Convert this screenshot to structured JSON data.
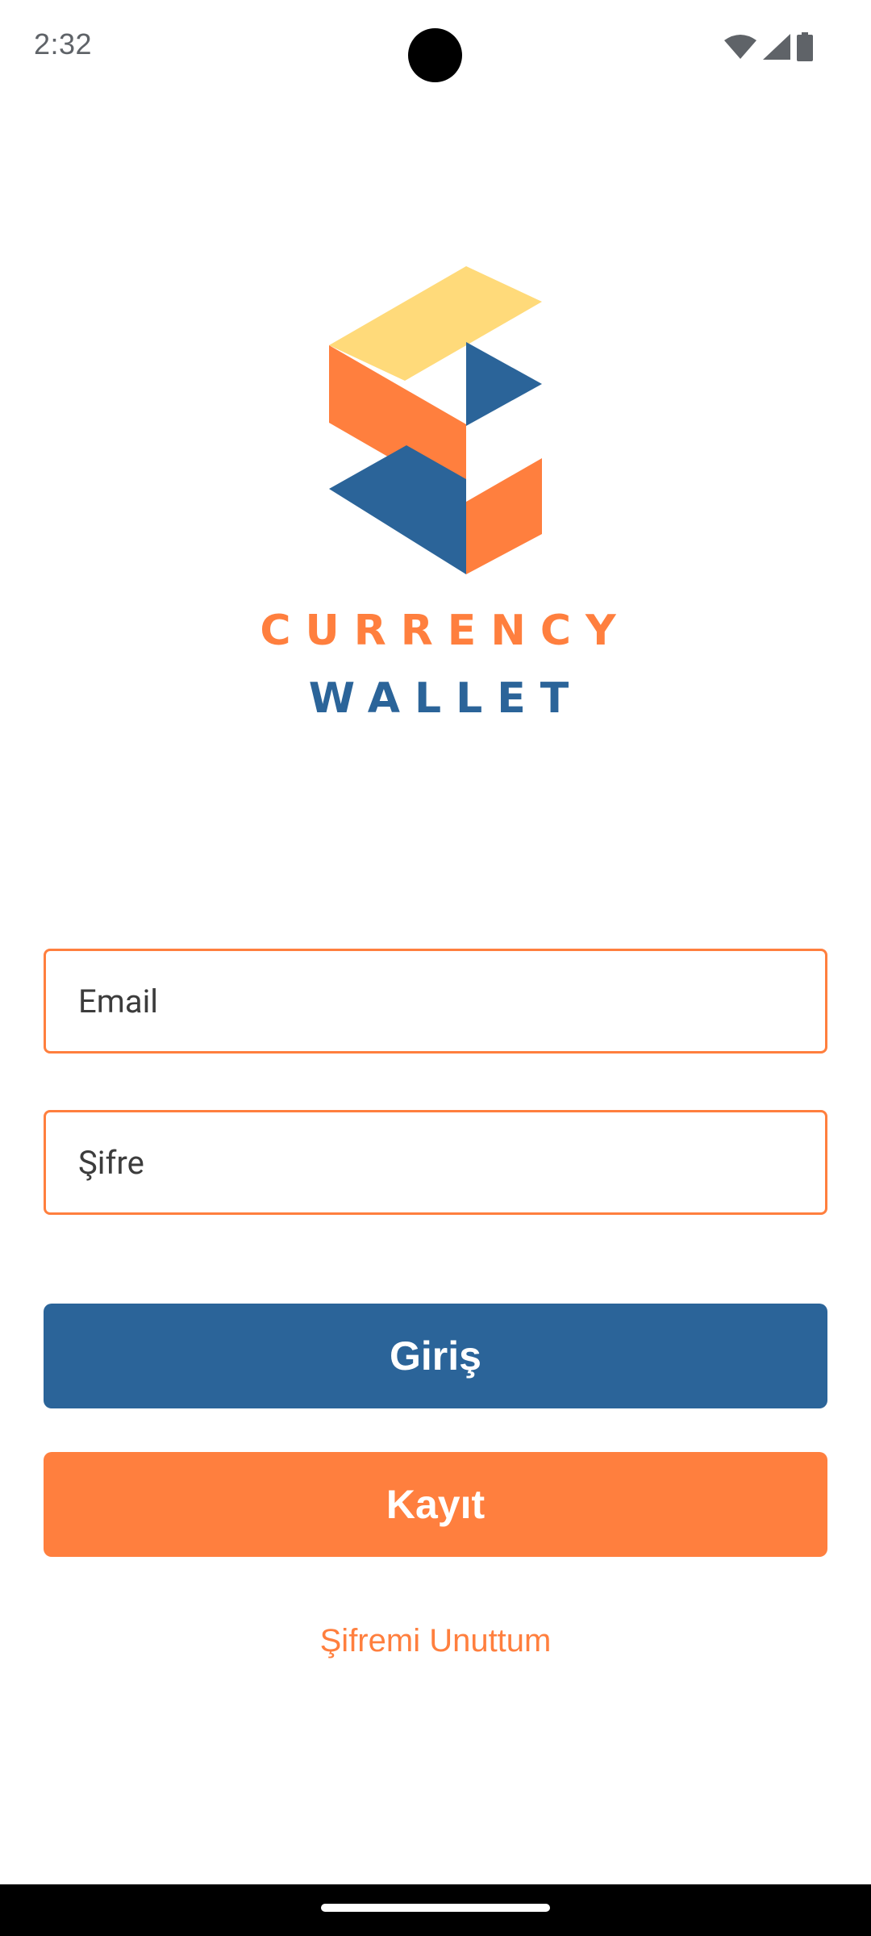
{
  "status_bar": {
    "time": "2:32"
  },
  "brand": {
    "line1": "CURRENCY",
    "line2": "WALLET",
    "colors": {
      "orange": "#FF7F3E",
      "blue": "#2B6499",
      "yellow": "#FFDA7A"
    }
  },
  "form": {
    "email_placeholder": "Email",
    "password_placeholder": "Şifre",
    "field_border_color": "#FF7F3E"
  },
  "buttons": {
    "login_label": "Giriş",
    "login_color": "#2B6499",
    "register_label": "Kayıt",
    "register_color": "#FF7F3E"
  },
  "links": {
    "forgot_password": "Şifremi Unuttum",
    "forgot_password_color": "#FF7F3E"
  },
  "icons": {
    "wifi": "wifi-icon",
    "signal": "signal-icon",
    "battery": "battery-icon",
    "logo": "currency-wallet-logo"
  }
}
